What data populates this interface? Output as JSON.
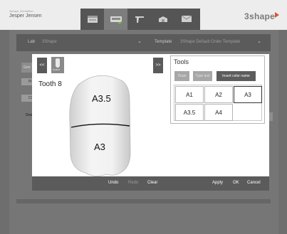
{
  "header": {
    "user_sub": "3shape_Dentalfirm",
    "user_name": "Jesper Jensen",
    "brand": "3shape",
    "toolbar_icons": [
      "order-form-icon",
      "scanner-icon",
      "design-icon",
      "box-icon",
      "message-icon"
    ]
  },
  "background": {
    "lab_label": "Lab",
    "lab_value": "3Shape",
    "template_label": "Template",
    "template_value": "3Shape Default Order Template",
    "side_labels": [
      "Gen",
      "Pl",
      "Cl",
      "Ove"
    ],
    "right_btn": "d"
  },
  "modal": {
    "prev_label": "<<",
    "next_label": ">>",
    "thumb_label": "Tooth 8",
    "tooth_title": "Tooth 8",
    "upper_shade": "A3.5",
    "lower_shade": "A3",
    "tools": {
      "title": "Tools",
      "draw_label": "Draw",
      "type_text_label": "Type text",
      "insert_color_label": "Insert color name",
      "shades": [
        "A1",
        "A2",
        "A3",
        "A3.5",
        "A4"
      ],
      "selected_shade": "A3"
    },
    "bottom": {
      "undo": "Undo",
      "redo": "Redo",
      "clear": "Clear",
      "apply": "Apply",
      "ok": "OK",
      "cancel": "Cancel"
    }
  }
}
